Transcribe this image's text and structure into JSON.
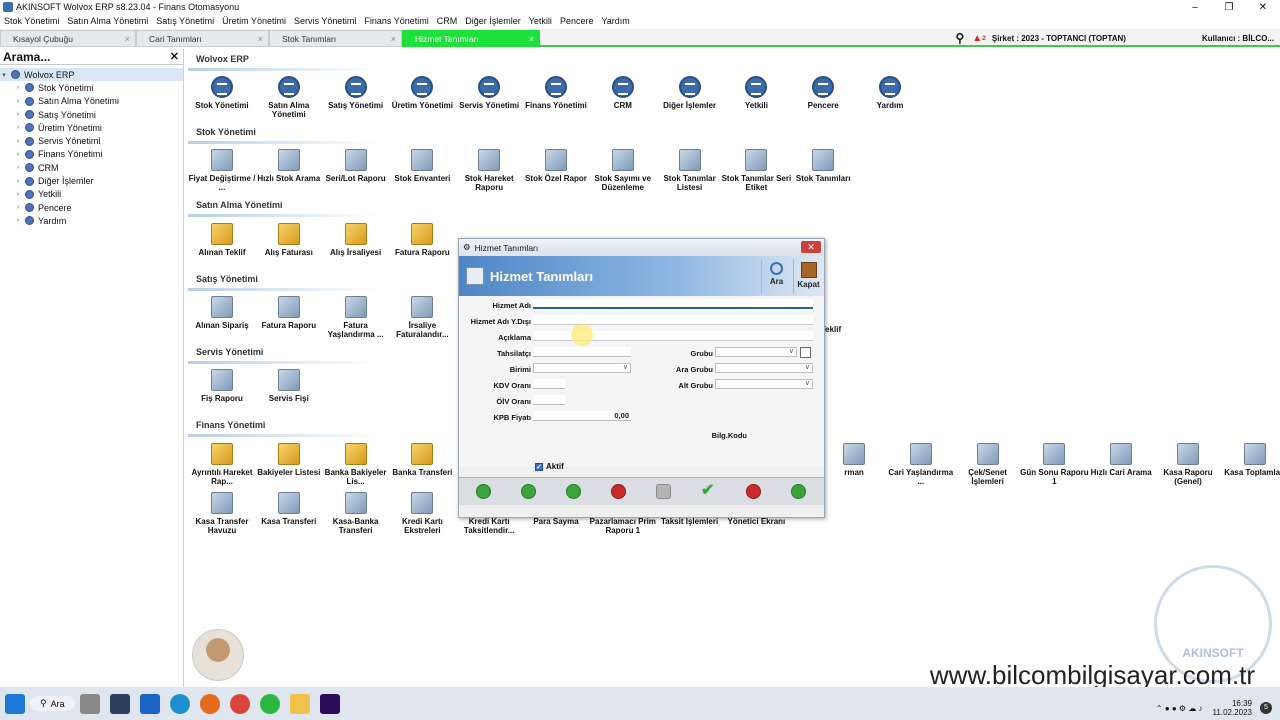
{
  "window": {
    "title": "AKINSOFT Wolvox ERP s8.23.04 - Finans Otomasyonu",
    "controls": [
      "–",
      "❐",
      "✕"
    ]
  },
  "menu": [
    "Stok Yönetimi",
    "Satın Alma Yönetimi",
    "Satış Yönetimi",
    "Üretim Yönetimi",
    "Servis Yönetimi",
    "Finans Yönetimi",
    "CRM",
    "Diğer İşlemler",
    "Yetkili",
    "Pencere",
    "Yardım"
  ],
  "tabs": [
    {
      "label": "Kısayol Çubuğu",
      "close": "×"
    },
    {
      "label": "Cari Tanımları",
      "close": "×"
    },
    {
      "label": "Stok Tanımları",
      "close": "×"
    },
    {
      "label": "Hizmet Tanımları",
      "close": "×"
    }
  ],
  "status": {
    "notif_count": "2",
    "sirket": "Şirket : 2023 - TOPTANCI (TOPTAN)",
    "kullanici": "Kullanıcı : BİLCO..."
  },
  "sidebar": {
    "search_label": "Arama...",
    "close": "✕",
    "root": "Wolvox ERP",
    "items": [
      "Stok Yönetimi",
      "Satın Alma Yönetimi",
      "Satış Yönetimi",
      "Üretim Yönetimi",
      "Servis Yönetimi",
      "Finans Yönetimi",
      "CRM",
      "Diğer İşlemler",
      "Yetkili",
      "Pencere",
      "Yardım"
    ]
  },
  "main": {
    "wolvox": {
      "title": "Wolvox ERP",
      "items": [
        "Stok Yönetimi",
        "Satın Alma Yönetimi",
        "Satış Yönetimi",
        "Üretim Yönetimi",
        "Servis Yönetimi",
        "Finans Yönetimi",
        "CRM",
        "Diğer İşlemler",
        "Yetkili",
        "Pencere",
        "Yardım"
      ]
    },
    "stok": {
      "title": "Stok Yönetimi",
      "items": [
        "Fiyat Değiştirme / ...",
        "Hızlı Stok Arama",
        "Seri/Lot Raporu",
        "Stok Envanteri",
        "Stok Hareket Raporu",
        "Stok Özel Rapor",
        "Stok Sayımı ve Düzenleme",
        "Stok Tanımlar Listesi",
        "Stok Tanımlar Seri Etiket",
        "Stok Tanımları"
      ]
    },
    "satinalma": {
      "title": "Satın Alma Yönetimi",
      "items": [
        "Alınan Teklif",
        "Alış Faturası",
        "Alış İrsaliyesi",
        "Fatura Raporu"
      ]
    },
    "satis": {
      "title": "Satış Yönetimi",
      "items": [
        "Alınan Sipariş",
        "Fatura Raporu",
        "Fatura Yaşlandırma ...",
        "İrsaliye Faturalandır..."
      ],
      "extra": "Teklif"
    },
    "servis": {
      "title": "Servis Yönetimi",
      "items": [
        "Fiş Raporu",
        "Servis Fişi"
      ]
    },
    "finans": {
      "title": "Finans Yönetimi",
      "row1": [
        "Ayrıntılı Hareket Rap...",
        "Bakiyeler Listesi",
        "Banka Bakiyeler Lis...",
        "Banka Transferi"
      ],
      "row1b": [
        "rman",
        "Cari Yaşlandırma ...",
        "Çek/Senet İşlemleri",
        "Gün Sonu Raporu 1",
        "Hızlı Cari Arama",
        "Kasa Raporu (Genel)",
        "Kasa Toplamları"
      ],
      "row2": [
        "Kasa Transfer Havuzu",
        "Kasa Transferi",
        "Kasa-Banka Transferi",
        "Kredi Kartı Ekstreleri",
        "Kredi Kartı Taksitlendir...",
        "Para Sayma",
        "Pazarlamacı Prim Raporu 1",
        "Taksit İşlemleri",
        "Yönetici Ekranı"
      ]
    }
  },
  "dialog": {
    "title": "Hizmet Tanımları",
    "header": "Hizmet Tanımları",
    "btn_ara": "Ara",
    "btn_kapat": "Kapat",
    "labels": {
      "hizmet_adi": "Hizmet Adı",
      "hizmet_adi_yd": "Hizmet Adı Y.Dışı",
      "aciklama": "Açıklama",
      "tahsilatci": "Tahsilatçı",
      "birimi": "Birimi",
      "kdv": "KDV Oranı",
      "oiv": "ÖİV Oranı",
      "kpb": "KPB Fiyatı",
      "grubu": "Grubu",
      "ara_grubu": "Ara Grubu",
      "alt_grubu": "Alt Grubu",
      "bilg_kodu": "Bilg.Kodu",
      "aktif": "Aktif"
    },
    "values": {
      "kpb": "0,00"
    }
  },
  "taskbar": {
    "search": "Ara",
    "time": "16:39",
    "date": "11.02.2023",
    "notif": "5"
  },
  "watermark": "www.bilcombilgisayar.com.tr",
  "logo": "AKINSOFT"
}
